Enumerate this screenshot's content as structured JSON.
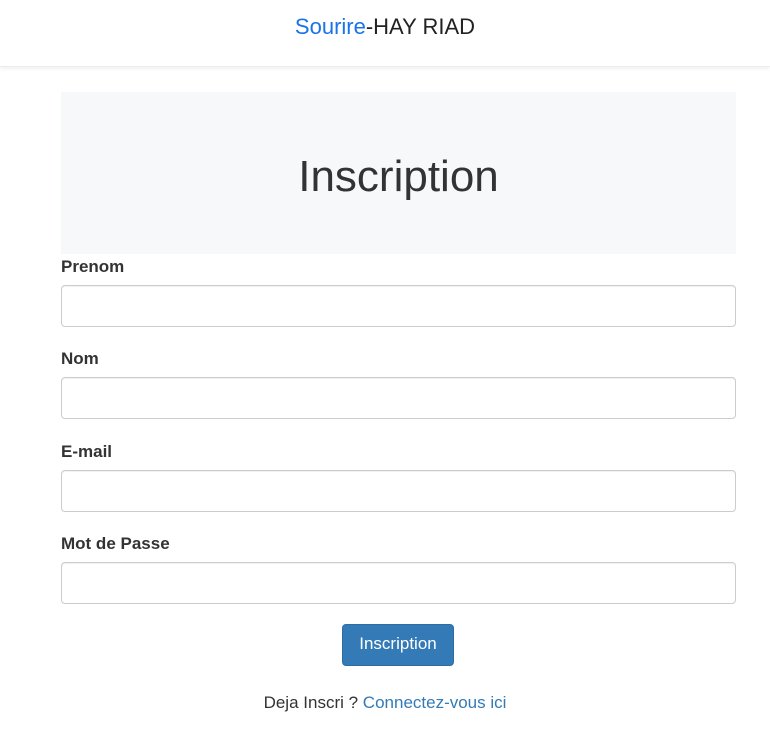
{
  "navbar": {
    "brand_accent": "Sourire",
    "brand_rest": "-HAY RIAD"
  },
  "hero": {
    "title": "Inscription"
  },
  "form": {
    "fields": [
      {
        "label": "Prenom",
        "value": "",
        "placeholder": ""
      },
      {
        "label": "Nom",
        "value": "",
        "placeholder": ""
      },
      {
        "label": "E-mail",
        "value": "",
        "placeholder": ""
      },
      {
        "label": "Mot de Passe",
        "value": "",
        "placeholder": ""
      }
    ],
    "submit_label": "Inscription"
  },
  "footer": {
    "prompt": "Deja Inscri ?",
    "link_label": "Connectez-vous ici"
  },
  "colors": {
    "accent": "#1a73e8",
    "button": "#337ab7",
    "link": "#337ab7",
    "hero_bg": "#f7f8f9"
  }
}
